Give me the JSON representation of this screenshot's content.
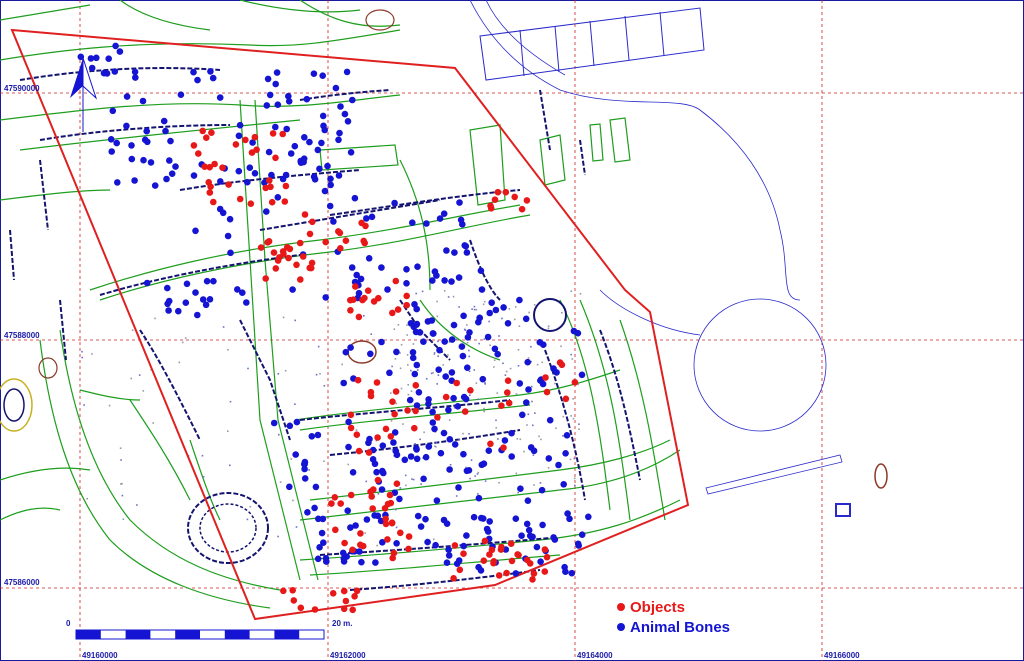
{
  "grid": {
    "x_labels": [
      "49160000",
      "49162000",
      "49164000",
      "49166000"
    ],
    "y_labels": [
      "47590000",
      "47588000",
      "47586000"
    ]
  },
  "scale_bar": {
    "start_label": "0",
    "end_label": "20 m."
  },
  "legend": {
    "objects": {
      "label": "Objects",
      "color": "#e81818"
    },
    "animal_bones": {
      "label": "Animal Bones",
      "color": "#1414d2"
    }
  },
  "colors": {
    "boundary": "#e02020",
    "features": "#1e9e1e",
    "outline": "#2a2acc",
    "grid": "#d02020",
    "earth": "#8b3a2a"
  },
  "icons": {
    "north_arrow": "north-arrow-icon"
  }
}
